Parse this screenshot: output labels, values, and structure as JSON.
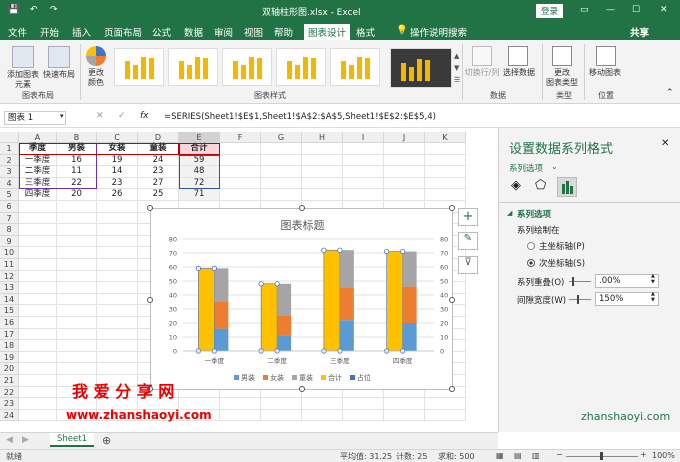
{
  "titlebar": {
    "filename": "双轴柱形图.xlsx - Excel",
    "login": "登录",
    "share": "共享"
  },
  "tabs": [
    "文件",
    "开始",
    "插入",
    "页面布局",
    "公式",
    "数据",
    "审阅",
    "视图",
    "帮助",
    "图表设计",
    "格式"
  ],
  "tell_me": "操作说明搜索",
  "ribbon": {
    "add_element": "添加图表\n元素",
    "quick_layout": "快速布局",
    "change_colors": "更改\n颜色",
    "switch_row_col": "切换行/列",
    "select_data": "选择数据",
    "change_type": "更改\n图表类型",
    "move_chart": "移动图表",
    "groups": {
      "layout": "图表布局",
      "styles": "图表样式",
      "data": "数据",
      "type": "类型",
      "location": "位置"
    }
  },
  "formula_bar": {
    "name_box": "图表 1",
    "fx": "fx",
    "formula": "=SERIES(Sheet1!$E$1,Sheet1!$A$2:$A$5,Sheet1!$E$2:$E$5,4)"
  },
  "sheet": {
    "columns": [
      "A",
      "B",
      "C",
      "D",
      "E",
      "F",
      "G",
      "H",
      "I",
      "J",
      "K"
    ],
    "rows": [
      "1",
      "2",
      "3",
      "4",
      "5",
      "6",
      "7",
      "8",
      "9",
      "10",
      "11",
      "12",
      "13",
      "14",
      "15",
      "16",
      "17",
      "18",
      "19",
      "20",
      "21",
      "22",
      "23",
      "24"
    ],
    "headers": [
      "季度",
      "男装",
      "女装",
      "童装",
      "合计"
    ],
    "data": [
      [
        "一季度",
        "16",
        "19",
        "24",
        "59"
      ],
      [
        "二季度",
        "11",
        "14",
        "23",
        "48"
      ],
      [
        "三季度",
        "22",
        "23",
        "27",
        "72"
      ],
      [
        "四季度",
        "20",
        "26",
        "25",
        "71"
      ]
    ],
    "tab": "Sheet1"
  },
  "chart": {
    "title": "图表标题",
    "y_ticks": [
      "0",
      "10",
      "20",
      "30",
      "40",
      "50",
      "60",
      "70",
      "80"
    ],
    "legend": [
      "男装",
      "女装",
      "童装",
      "合计",
      "占位"
    ],
    "colors": {
      "男装": "#5b9bd5",
      "女装": "#ed7d31",
      "童装": "#a5a5a5",
      "合计": "#ffc000",
      "占位": "#4472c4"
    }
  },
  "chart_data": {
    "type": "bar",
    "title": "图表标题",
    "categories": [
      "一季度",
      "二季度",
      "三季度",
      "四季度"
    ],
    "series": [
      {
        "name": "男装",
        "values": [
          16,
          11,
          22,
          20
        ]
      },
      {
        "name": "女装",
        "values": [
          19,
          14,
          23,
          26
        ]
      },
      {
        "name": "童装",
        "values": [
          24,
          23,
          27,
          25
        ]
      },
      {
        "name": "合计",
        "values": [
          59,
          48,
          72,
          71
        ]
      },
      {
        "name": "占位",
        "values": [
          0,
          0,
          0,
          0
        ]
      }
    ],
    "ylim": [
      0,
      80
    ],
    "legend": "bottom",
    "grid": true
  },
  "pane": {
    "title": "设置数据系列格式",
    "series_options_dropdown": "系列选项",
    "section": "系列选项",
    "plot_on": "系列绘制在",
    "primary_axis": "主坐标轴(P)",
    "secondary_axis": "次坐标轴(S)",
    "overlap_label": "系列重叠(O)",
    "overlap_value": ".00%",
    "gap_label": "间隙宽度(W)",
    "gap_value": "150%"
  },
  "watermark": {
    "line1": "我 爱 分 享 网",
    "line2": "www.zhanshaoyi.com",
    "corner": "zhanshaoyi.com"
  },
  "status": {
    "ready": "就绪",
    "avg": "平均值: 31.25",
    "count": "计数: 25",
    "sum": "求和: 500",
    "zoom": "100%"
  }
}
